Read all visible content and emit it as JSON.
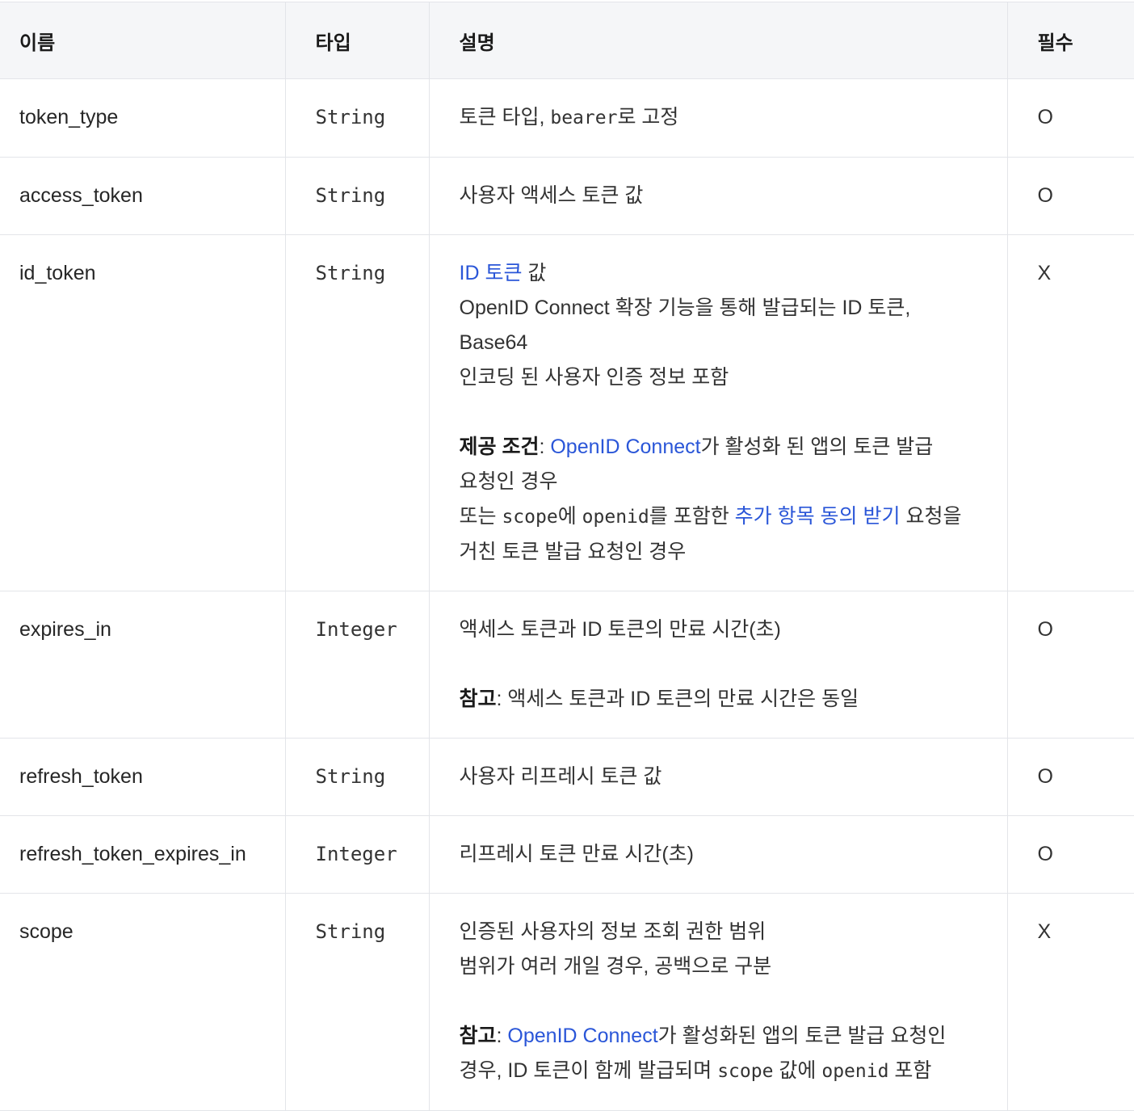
{
  "table": {
    "headers": {
      "name": "이름",
      "type": "타입",
      "description": "설명",
      "required": "필수"
    },
    "rows": [
      {
        "name": "token_type",
        "type": "String",
        "desc": {
          "pre": "토큰 타입, ",
          "code": "bearer",
          "post": "로 고정"
        },
        "required": "O"
      },
      {
        "name": "access_token",
        "type": "String",
        "desc": {
          "text": "사용자 액세스 토큰 값"
        },
        "required": "O"
      },
      {
        "name": "id_token",
        "type": "String",
        "desc": {
          "l1_link": "ID 토큰",
          "l1_post": " 값",
          "l2": "OpenID Connect 확장 기능을 통해 발급되는 ID 토큰, Base64",
          "l3": "인코딩 된 사용자 인증 정보 포함",
          "l4_label": "제공 조건",
          "l4_sep": ": ",
          "l4_link": "OpenID Connect",
          "l4_post": "가 활성화 된 앱의 토큰 발급",
          "l5": "요청인 경우",
          "l6_pre": "또는 ",
          "l6_code1": "scope",
          "l6_mid1": "에 ",
          "l6_code2": "openid",
          "l6_mid2": "를 포함한 ",
          "l6_link": "추가 항목 동의 받기",
          "l6_post": " 요청을",
          "l7": "거친 토큰 발급 요청인 경우"
        },
        "required": "X"
      },
      {
        "name": "expires_in",
        "type": "Integer",
        "desc": {
          "l1": "액세스 토큰과 ID 토큰의 만료 시간(초)",
          "l2_label": "참고",
          "l2_post": ": 액세스 토큰과 ID 토큰의 만료 시간은 동일"
        },
        "required": "O"
      },
      {
        "name": "refresh_token",
        "type": "String",
        "desc": {
          "text": "사용자 리프레시 토큰 값"
        },
        "required": "O"
      },
      {
        "name": "refresh_token_expires_in",
        "type": "Integer",
        "desc": {
          "text": "리프레시 토큰 만료 시간(초)"
        },
        "required": "O"
      },
      {
        "name": "scope",
        "type": "String",
        "desc": {
          "l1": "인증된 사용자의 정보 조회 권한 범위",
          "l2": "범위가 여러 개일 경우, 공백으로 구분",
          "l3_label": "참고",
          "l3_sep": ": ",
          "l3_link": "OpenID Connect",
          "l3_post": "가 활성화된 앱의 토큰 발급 요청인",
          "l4_pre": "경우, ID 토큰이 함께 발급되며 ",
          "l4_code1": "scope",
          "l4_mid": " 값에 ",
          "l4_code2": "openid",
          "l4_post": " 포함"
        },
        "required": "X"
      }
    ]
  },
  "colors": {
    "link": "#2a56d8",
    "header_bg": "#f5f6f8",
    "border": "#e3e5e9"
  }
}
